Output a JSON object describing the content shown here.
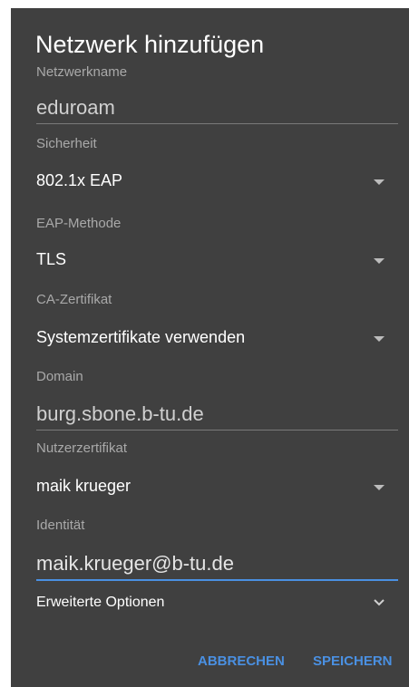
{
  "dialog": {
    "title": "Netzwerk hinzufügen",
    "fields": {
      "network_name": {
        "label": "Netzwerkname",
        "value": "eduroam"
      },
      "security": {
        "label": "Sicherheit",
        "value": "802.1x EAP"
      },
      "eap_method": {
        "label": "EAP-Methode",
        "value": "TLS"
      },
      "ca_certificate": {
        "label": "CA-Zertifikat",
        "value": "Systemzertifikate verwenden"
      },
      "domain": {
        "label": "Domain",
        "value": "burg.sbone.b-tu.de"
      },
      "user_certificate": {
        "label": "Nutzerzertifikat",
        "value": "maik krueger"
      },
      "identity": {
        "label": "Identität",
        "value": "maik.krueger@b-tu.de"
      }
    },
    "advanced_options": "Erweiterte Optionen",
    "buttons": {
      "cancel": "ABBRECHEN",
      "save": "SPEICHERN"
    }
  },
  "icons": {
    "dropdown": "dropdown-arrow-icon",
    "expand": "chevron-down-icon"
  },
  "colors": {
    "dialog_background": "#404040",
    "accent": "#4a90e2",
    "label": "#a9a9a9"
  }
}
